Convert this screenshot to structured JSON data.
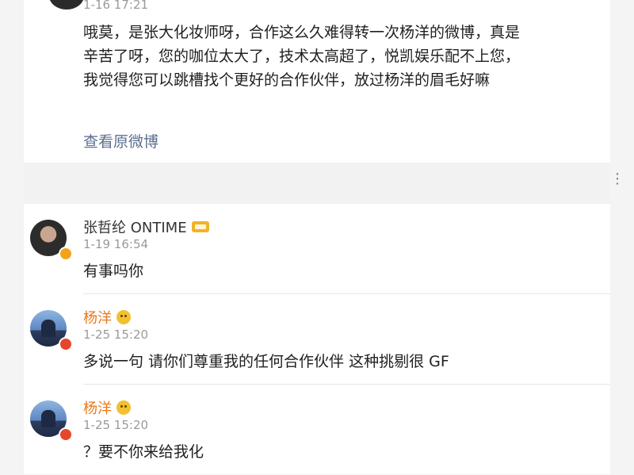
{
  "post": {
    "time": "1-16 17:21",
    "text": "哦莫，是张大化妆师呀，合作这么久难得转一次杨洋的微博，真是辛苦了呀，您的咖位太大了，技术太高超了，悦凯娱乐配不上您，我觉得您可以跳槽找个更好的合作伙伴，放过杨洋的眉毛好嘛",
    "view_original": "查看原微博"
  },
  "comments": [
    {
      "name": "张哲纶 ONTIME",
      "time": "1-19 16:54",
      "text": "有事吗你",
      "name_color": "#333333",
      "badge_icon": "level-icon"
    },
    {
      "name": "杨洋",
      "time": "1-25 15:20",
      "text": "多说一句 请你们尊重我的任何合作伙伴 这种挑剔很 GF",
      "name_color": "#e8791a",
      "badge_icon": "emoji-icon"
    },
    {
      "name": "杨洋",
      "time": "1-25 15:20",
      "text": "？要不你来给我化",
      "name_color": "#e8791a",
      "badge_icon": "emoji-icon"
    }
  ]
}
